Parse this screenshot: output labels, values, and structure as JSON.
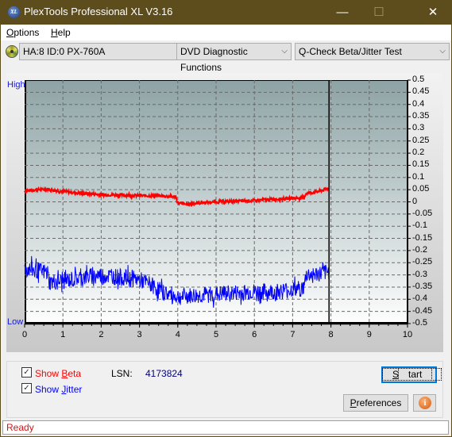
{
  "window": {
    "title": "PlexTools Professional XL V3.16",
    "logo_text": "XL",
    "minimize": "—",
    "maximize": "☐",
    "close": "✕"
  },
  "menu": [
    {
      "label": "Options",
      "accel": "O",
      "rest": "ptions"
    },
    {
      "label": "Help",
      "accel": "H",
      "rest": "elp"
    }
  ],
  "toolbar": {
    "drive": "HA:8 ID:0  PX-760A",
    "function": "DVD Diagnostic Functions",
    "test": "Q-Check Beta/Jitter Test",
    "arrow": "⌵"
  },
  "chart_labels": {
    "high": "High",
    "low": "Low"
  },
  "chart_data": {
    "type": "line",
    "title": "",
    "xlabel": "",
    "ylabel": "",
    "xlim": [
      0,
      10
    ],
    "ylim": [
      -0.5,
      0.5
    ],
    "grid": true,
    "x_ticks": [
      "0",
      "1",
      "2",
      "3",
      "4",
      "5",
      "6",
      "7",
      "8",
      "9",
      "10"
    ],
    "y_ticks": [
      "0.5",
      "0.45",
      "0.4",
      "0.35",
      "0.3",
      "0.25",
      "0.2",
      "0.15",
      "0.1",
      "0.05",
      "0",
      "-0.05",
      "-0.1",
      "-0.15",
      "-0.2",
      "-0.25",
      "-0.3",
      "-0.35",
      "-0.4",
      "-0.45",
      "-0.5"
    ],
    "cursor_x": 7.95,
    "series": [
      {
        "name": "Beta",
        "color": "#ff0000",
        "x": [
          0,
          0.3,
          0.6,
          0.9,
          1.2,
          1.5,
          2.0,
          2.5,
          3.0,
          3.5,
          3.95,
          4.0,
          4.2,
          4.5,
          5.0,
          5.5,
          6.0,
          6.5,
          7.0,
          7.3,
          7.35,
          7.6,
          7.95
        ],
        "y": [
          0.045,
          0.05,
          0.052,
          0.045,
          0.04,
          0.035,
          0.03,
          0.028,
          0.025,
          0.025,
          0.02,
          -0.005,
          -0.01,
          -0.005,
          0.0,
          0.003,
          0.005,
          0.01,
          0.015,
          0.018,
          0.035,
          0.04,
          0.055
        ]
      },
      {
        "name": "Jitter",
        "color": "#0000ff",
        "x": [
          0,
          0.3,
          0.6,
          0.65,
          1.0,
          1.5,
          2.0,
          2.5,
          3.0,
          3.3,
          3.6,
          4.0,
          4.5,
          5.0,
          5.5,
          6.0,
          6.5,
          7.0,
          7.3,
          7.35,
          7.6,
          7.95
        ],
        "y": [
          -0.275,
          -0.28,
          -0.29,
          -0.33,
          -0.325,
          -0.31,
          -0.3,
          -0.31,
          -0.32,
          -0.34,
          -0.37,
          -0.39,
          -0.385,
          -0.38,
          -0.375,
          -0.37,
          -0.37,
          -0.36,
          -0.355,
          -0.3,
          -0.3,
          -0.29
        ],
        "noise": 0.035
      }
    ]
  },
  "controls": {
    "show_beta": {
      "label_pre": "Show ",
      "accel": "B",
      "label_post": "eta",
      "checked": true,
      "color": "#ff0000"
    },
    "show_jitter": {
      "label_pre": "Show ",
      "accel": "J",
      "label_post": "itter",
      "checked": true,
      "color": "#0000ff"
    },
    "lsn_label": "LSN:",
    "lsn_value": "4173824",
    "start": {
      "accel": "S",
      "rest": "tart"
    },
    "preferences": {
      "accel": "P",
      "rest": "references"
    },
    "info_icon": "i"
  },
  "status": "Ready"
}
